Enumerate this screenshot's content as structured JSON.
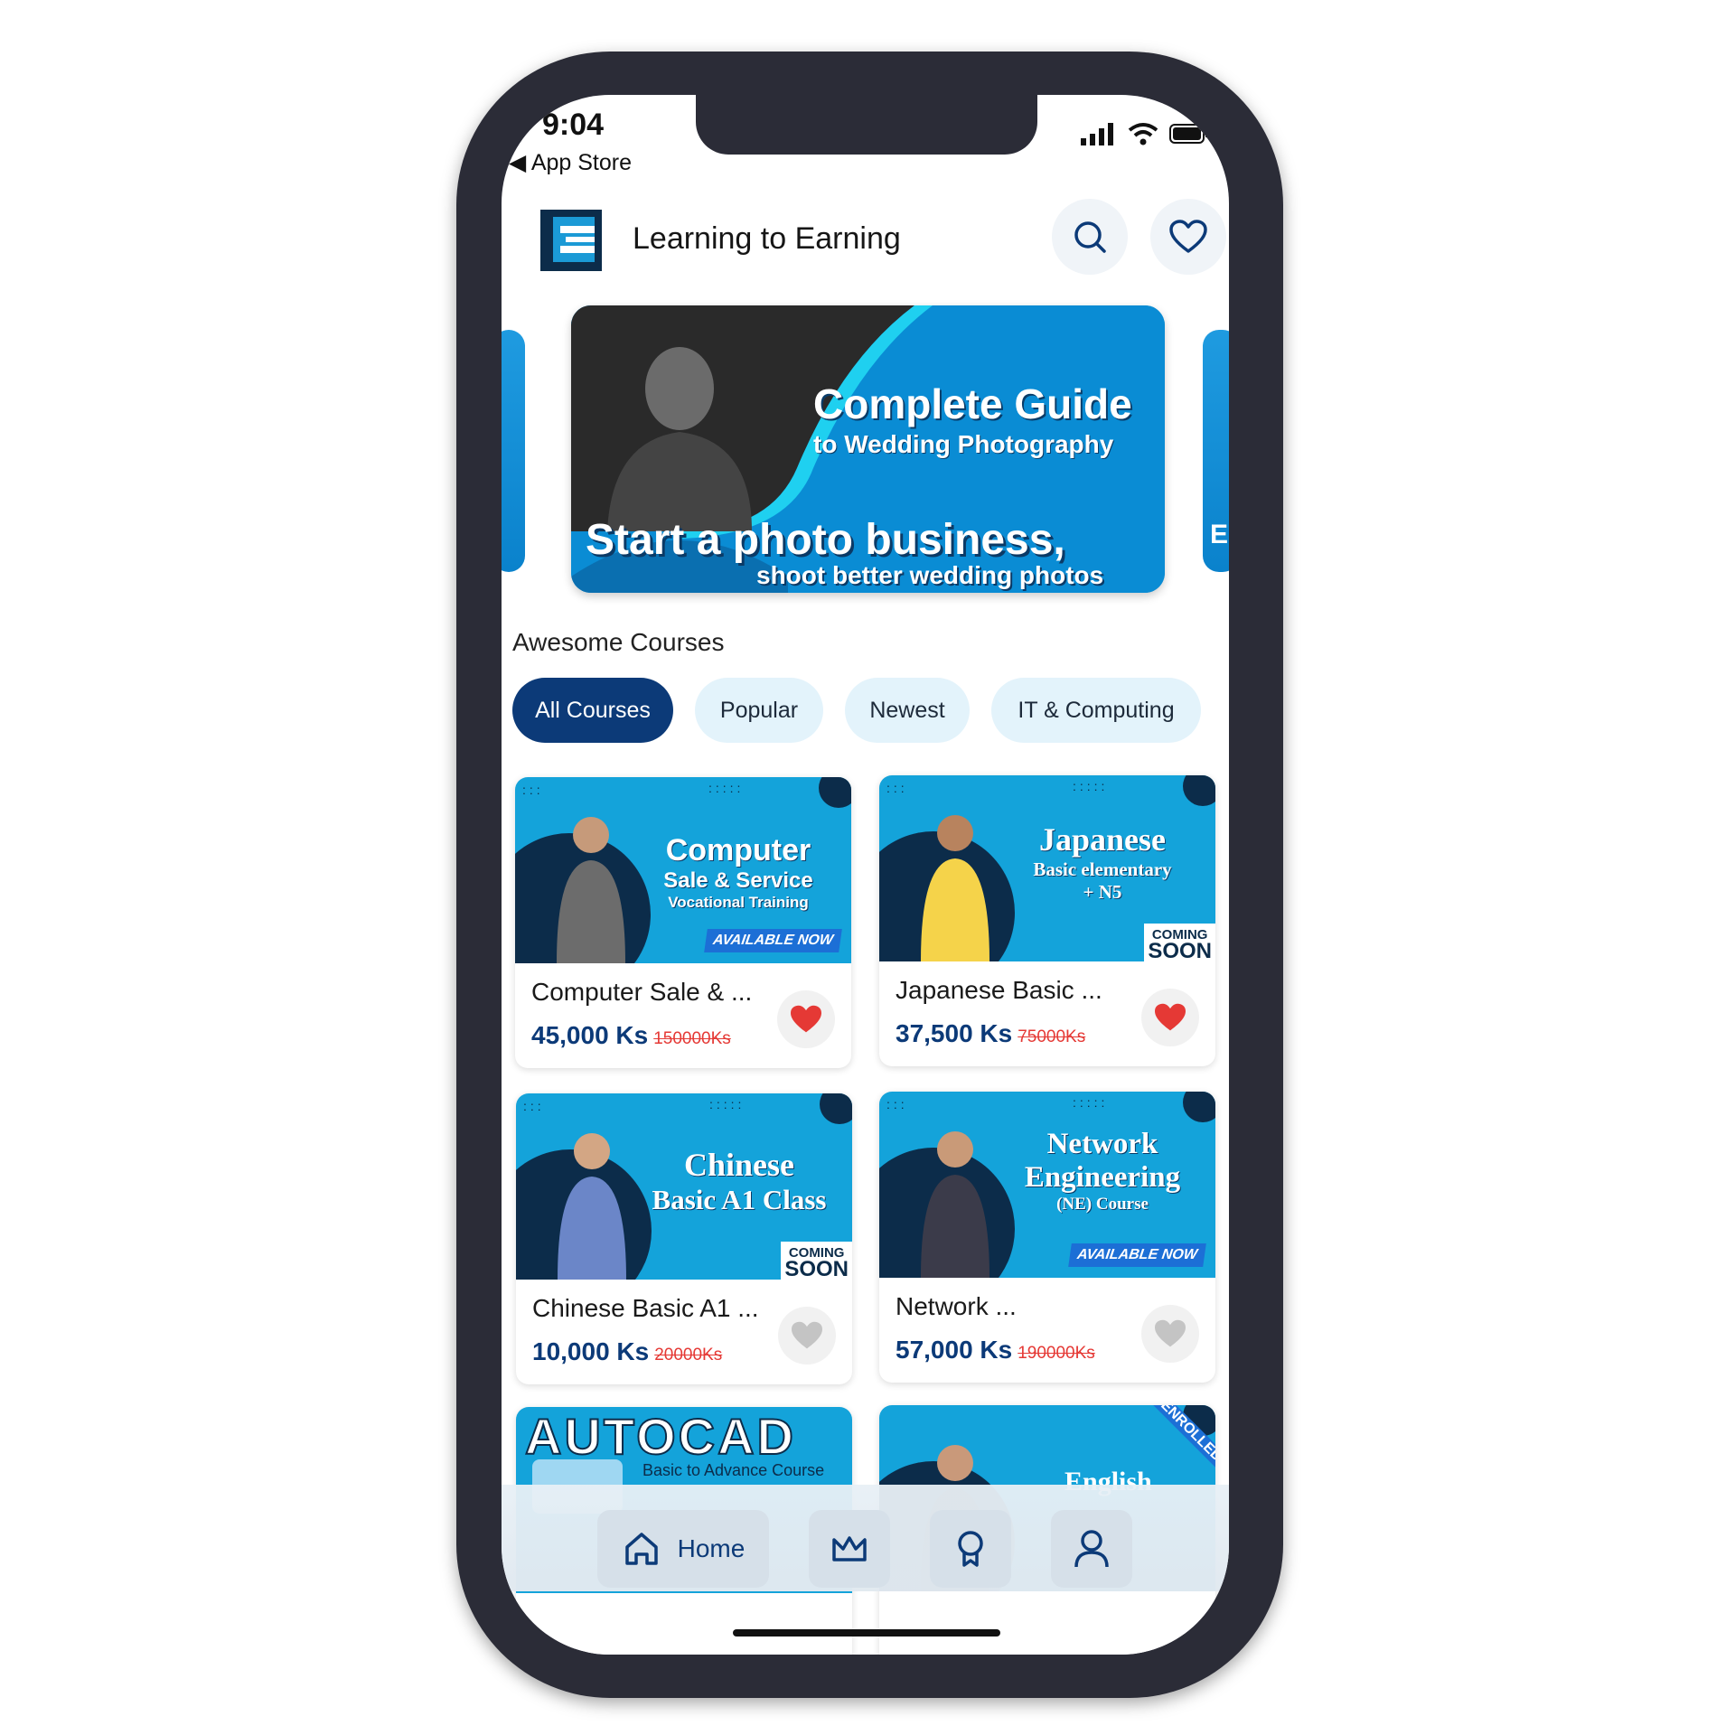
{
  "status_bar": {
    "time": "9:04",
    "back_label": "App Store"
  },
  "header": {
    "title": "Learning to Earning"
  },
  "banner": {
    "title": "Complete Guide",
    "subtitle": "to Wedding Photography",
    "headline": "Start a photo business,",
    "tagline": "shoot better wedding photos",
    "next_peek_letter": "E"
  },
  "section": {
    "title": "Awesome Courses"
  },
  "chips": [
    {
      "label": "All Courses",
      "active": true
    },
    {
      "label": "Popular",
      "active": false
    },
    {
      "label": "Newest",
      "active": false
    },
    {
      "label": "IT & Computing",
      "active": false
    }
  ],
  "courses": [
    {
      "thumb_line1": "Computer",
      "thumb_line2": "Sale & Service",
      "thumb_line3": "Vocational Training",
      "badge": "AVAILABLE NOW",
      "name": "Computer Sale & ...",
      "price": "45,000 Ks",
      "old_price": "150000Ks",
      "favorited": true
    },
    {
      "thumb_line1": "Japanese",
      "thumb_line2": "Basic elementary",
      "thumb_line3": "+ N5",
      "badge_top": "COMING",
      "badge_bottom": "SOON",
      "name": "Japanese Basic ...",
      "price": "37,500 Ks",
      "old_price": "75000Ks",
      "favorited": true
    },
    {
      "thumb_line1": "Chinese",
      "thumb_line2": "Basic A1 Class",
      "badge_top": "COMING",
      "badge_bottom": "SOON",
      "name": "Chinese Basic A1 ...",
      "price": "10,000 Ks",
      "old_price": "20000Ks",
      "favorited": false
    },
    {
      "thumb_line1": "Network",
      "thumb_line2": "Engineering",
      "thumb_line3": "(NE) Course",
      "badge": "AVAILABLE NOW",
      "name": "Network ...",
      "price": "57,000 Ks",
      "old_price": "190000Ks",
      "favorited": false
    },
    {
      "thumb_line1": "AUTOCAD",
      "thumb_line2": "Basic to Advance Course"
    },
    {
      "thumb_line1": "English",
      "ribbon": "ENROLLED"
    }
  ],
  "bottom_nav": {
    "items": [
      {
        "label": "Home",
        "icon": "home-icon",
        "active": true
      },
      {
        "icon": "crown-icon"
      },
      {
        "icon": "award-icon"
      },
      {
        "icon": "profile-icon"
      }
    ]
  },
  "colors": {
    "primary": "#0c3a78",
    "accent": "#14a3da",
    "price_old": "#e53935",
    "heart": "#e53935"
  }
}
